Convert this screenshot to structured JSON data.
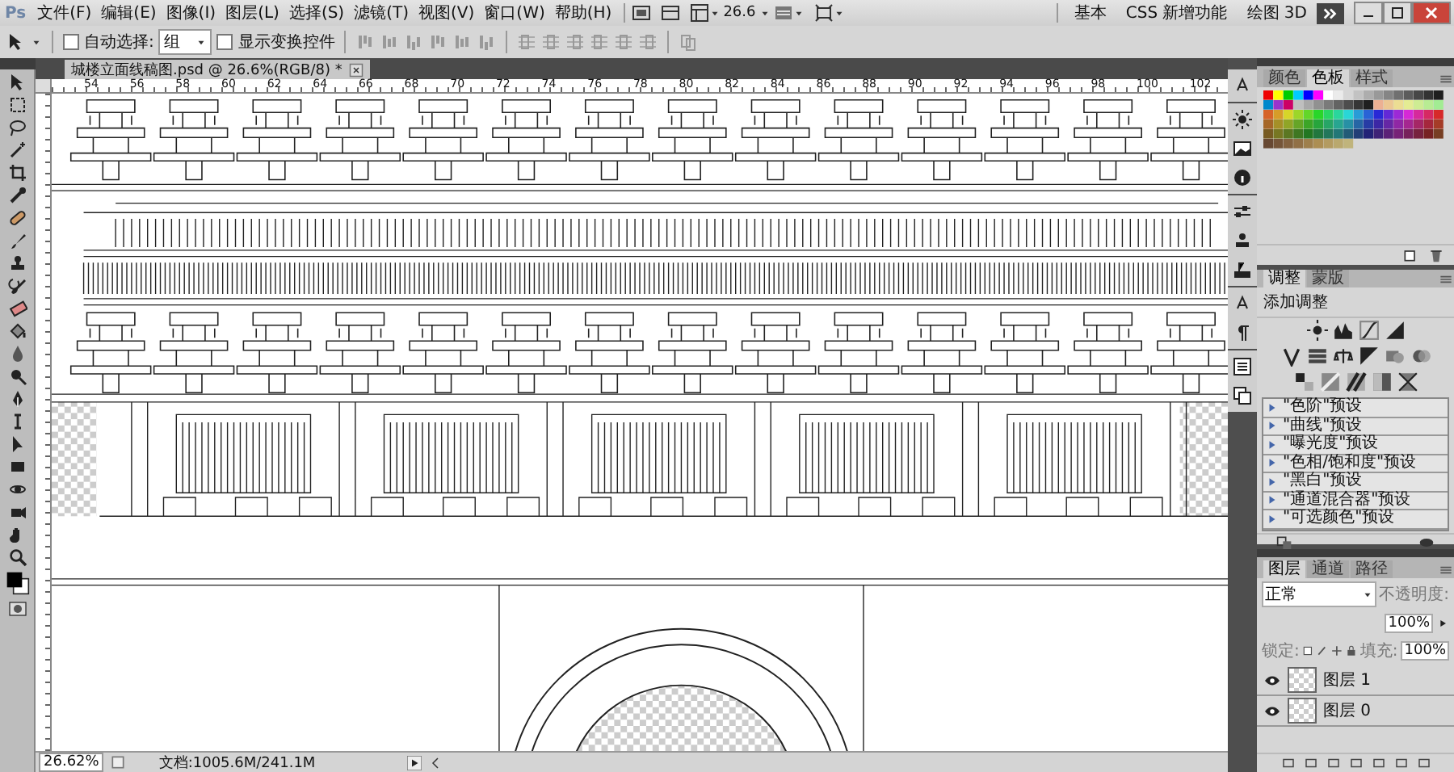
{
  "menu_bar": {
    "logo": "Ps",
    "menus": [
      "文件(F)",
      "编辑(E)",
      "图像(I)",
      "图层(L)",
      "选择(S)",
      "滤镜(T)",
      "视图(V)",
      "窗口(W)",
      "帮助(H)"
    ],
    "zoom": "26.6",
    "workspaces": [
      "基本",
      "CSS 新增功能",
      "绘图 3D"
    ]
  },
  "options_bar": {
    "auto_select": {
      "label": "自动选择:",
      "checked": false
    },
    "auto_select_target": "组",
    "show_transform": {
      "label": "显示变换控件",
      "checked": false
    }
  },
  "document": {
    "tab_title": "城楼立面线稿图.psd @ 26.6%(RGB/8) *",
    "ruler_labels": [
      "54",
      "56",
      "58",
      "60",
      "62",
      "64",
      "66",
      "68",
      "70",
      "72",
      "74",
      "76",
      "78",
      "80",
      "82",
      "84",
      "86",
      "88",
      "90",
      "92",
      "94",
      "96",
      "98",
      "100",
      "102"
    ]
  },
  "swatches_panel": {
    "tabs": [
      {
        "label": "颜色",
        "selected": false
      },
      {
        "label": "色板",
        "selected": true
      },
      {
        "label": "样式",
        "selected": false
      }
    ]
  },
  "adjustments_panel": {
    "tabs": [
      {
        "label": "调整",
        "selected": true
      },
      {
        "label": "蒙版",
        "selected": false
      }
    ],
    "title": "添加调整",
    "presets": [
      "\"色阶\"预设",
      "\"曲线\"预设",
      "\"曝光度\"预设",
      "\"色相/饱和度\"预设",
      "\"黑白\"预设",
      "\"通道混合器\"预设",
      "\"可选颜色\"预设"
    ]
  },
  "layers_panel": {
    "tabs": [
      {
        "label": "图层",
        "selected": true
      },
      {
        "label": "通道",
        "selected": false
      },
      {
        "label": "路径",
        "selected": false
      }
    ],
    "blend_mode": "正常",
    "opacity_label": "不透明度:",
    "opacity": "100%",
    "lock_label": "锁定:",
    "fill_label": "填充:",
    "fill": "100%",
    "layers": [
      {
        "name": "图层 1",
        "visible": true,
        "selected": false
      },
      {
        "name": "图层 0",
        "visible": true,
        "selected": false
      }
    ]
  },
  "status_bar": {
    "zoom": "26.62%",
    "doc_info": "文档:1005.6M/241.1M"
  }
}
